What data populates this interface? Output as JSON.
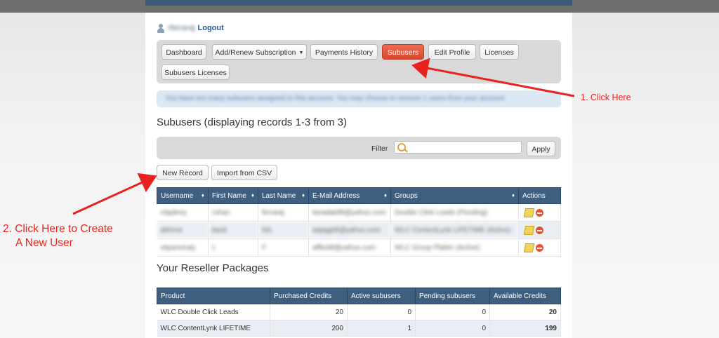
{
  "user": {
    "name": "rferraraj",
    "logout": "Logout"
  },
  "nav": [
    {
      "label": "Dashboard",
      "active": false
    },
    {
      "label": "Add/Renew Subscription",
      "active": false,
      "dropdown": true
    },
    {
      "label": "Payments History",
      "active": false
    },
    {
      "label": "Subusers",
      "active": true
    },
    {
      "label": "Edit Profile",
      "active": false
    },
    {
      "label": "Licenses",
      "active": false
    },
    {
      "label": "Subusers Licenses",
      "active": false
    }
  ],
  "info_message": "You have too many subusers assigned to this account. You may choose to remove 1 users from your account",
  "subusers": {
    "heading": "Subusers (displaying records 1-3 from 3)",
    "filter_label": "Filter",
    "filter_value": "",
    "apply": "Apply",
    "new_record": "New Record",
    "import_csv": "Import from CSV",
    "columns": [
      "Username",
      "First Name",
      "Last Name",
      "E-Mail Address",
      "Groups",
      "Actions"
    ],
    "rows": [
      [
        "clapbrey",
        "rohan",
        "ferraraj",
        "lazadak88@yahoo.com",
        "Double Click Leads (Pending)"
      ],
      [
        "abhrne",
        "basil",
        "NIL",
        "aajagj08@yahoo.com",
        "WLC ContentLynk LIFETIME (Active)"
      ],
      [
        "sitpanviraly",
        "c",
        "F",
        "afflicti8@yahoo.com",
        "WLC Group Platter (Active)"
      ]
    ]
  },
  "packages": {
    "heading": "Your Reseller Packages",
    "columns": [
      "Product",
      "Purchased Credits",
      "Active subusers",
      "Pending subusers",
      "Available Credits"
    ],
    "rows": [
      [
        "WLC Double Click Leads",
        "20",
        "0",
        "0",
        "20"
      ],
      [
        "WLC ContentLynk LIFETIME",
        "200",
        "1",
        "0",
        "199"
      ]
    ]
  },
  "annotations": {
    "step1": "1. Click Here",
    "step2_line1": "2. Click Here to Create",
    "step2_line2": "A New User",
    "color": "#e8231f"
  },
  "icons": {
    "user": "user-icon",
    "search": "magnifier-icon",
    "edit": "pencil-icon",
    "delete": "minus-circle-icon"
  }
}
